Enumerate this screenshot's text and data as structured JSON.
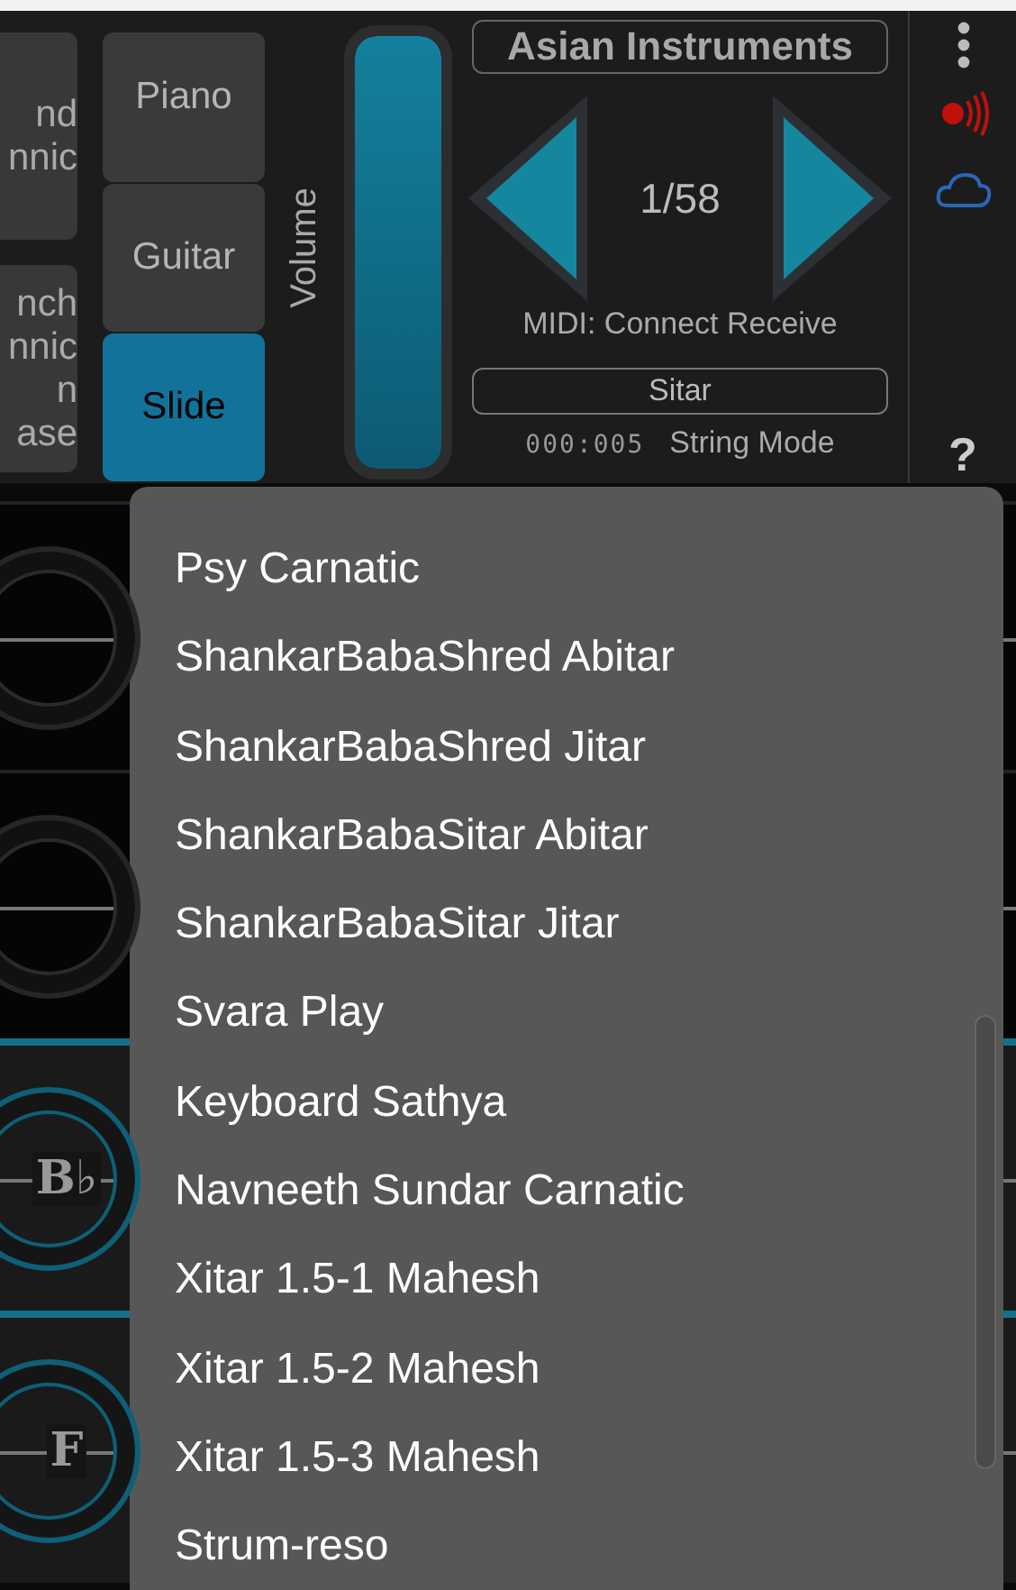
{
  "left_buttons": [
    {
      "lines": [
        "nd",
        "nnic"
      ]
    },
    {
      "lines": [
        "nch",
        "nnic",
        "n",
        "ase"
      ]
    }
  ],
  "modes": [
    {
      "label": "Piano",
      "selected": false
    },
    {
      "label": "Guitar",
      "selected": false
    },
    {
      "label": "Slide",
      "selected": true
    }
  ],
  "volume": {
    "label": "Volume",
    "level": 1
  },
  "instrument_panel": {
    "category": "Asian Instruments",
    "counter": "1/58",
    "midi": "MIDI: Connect Receive",
    "preset": "Sitar",
    "code": "000:005",
    "mode": "String Mode"
  },
  "side": {
    "help": "?"
  },
  "strings": [
    {
      "active": false
    },
    {
      "active": false
    },
    {
      "note": "B♭",
      "active": true
    },
    {
      "note": "F",
      "active": true
    }
  ],
  "menu": {
    "items": [
      "Psy Carnatic",
      "ShankarBabaShred Abitar",
      "ShankarBabaShred Jitar",
      "ShankarBabaSitar Abitar",
      "ShankarBabaSitar Jitar",
      "Svara Play",
      "Keyboard Sathya",
      "Navneeth Sundar Carnatic",
      "Xitar 1.5-1 Mahesh",
      "Xitar 1.5-2 Mahesh",
      "Xitar 1.5-3 Mahesh",
      "Strum-reso"
    ]
  }
}
